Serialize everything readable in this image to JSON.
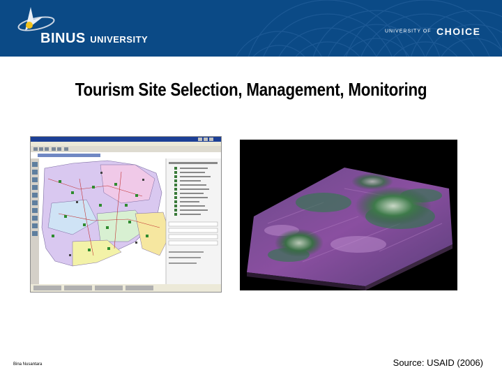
{
  "header": {
    "logo_primary": "BINUS",
    "logo_secondary": "UNIVERSITY",
    "tagline_prefix": "UNIVERSITY OF",
    "tagline_main": "CHOICE"
  },
  "slide": {
    "title": "Tourism Site Selection, Management, Monitoring"
  },
  "footer": {
    "left_text": "Bina Nusantara",
    "source": "Source: USAID (2006)"
  },
  "colors": {
    "header_bg": "#0b4a86",
    "title_text": "#000000"
  },
  "images": {
    "left": "gis-application-screenshot",
    "right": "3d-satellite-terrain-render"
  }
}
